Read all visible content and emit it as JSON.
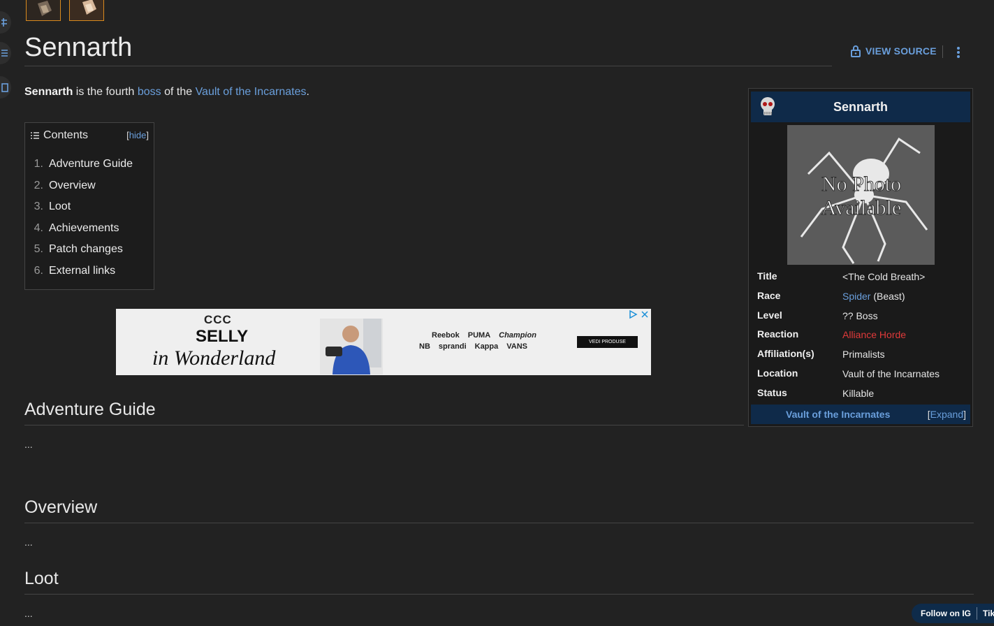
{
  "page": {
    "title": "Sennarth",
    "view_source": "VIEW SOURCE"
  },
  "intro": {
    "subject": "Sennarth",
    "text1": " is the fourth ",
    "link1": "boss",
    "text2": " of the ",
    "link2": "Vault of the Incarnates",
    "text3": "."
  },
  "toc": {
    "title": "Contents",
    "hide_open": "[",
    "hide": "hide",
    "hide_close": "]",
    "items": [
      {
        "num": "1.",
        "label": "Adventure Guide"
      },
      {
        "num": "2.",
        "label": "Overview"
      },
      {
        "num": "3.",
        "label": "Loot"
      },
      {
        "num": "4.",
        "label": "Achievements"
      },
      {
        "num": "5.",
        "label": "Patch changes"
      },
      {
        "num": "6.",
        "label": "External links"
      }
    ]
  },
  "ad": {
    "brand_top": "CCC",
    "brand_mid": "SELLY",
    "brand_script": "in Wonderland",
    "logos_row1": [
      "Reebok",
      "PUMA",
      "Champion"
    ],
    "logos_row2": [
      "NB",
      "sprandi",
      "Kappa",
      "VANS"
    ],
    "cta": "VEDI PRODUSE"
  },
  "sections": [
    {
      "heading": "Adventure Guide",
      "body": "..."
    },
    {
      "heading": "Overview",
      "body": "..."
    },
    {
      "heading": "Loot",
      "body": "..."
    }
  ],
  "infobox": {
    "name": "Sennarth",
    "photo_text_line1": "No Photo",
    "photo_text_line2": "Available",
    "rows": [
      {
        "label": "Title",
        "value": "<The Cold Breath>"
      },
      {
        "label": "Race",
        "link": "Spider",
        "value": " (Beast)"
      },
      {
        "label": "Level",
        "value": "?? Boss"
      },
      {
        "label": "Reaction",
        "value": "Alliance Horde"
      },
      {
        "label": "Affiliation(s)",
        "link": "Primalists"
      },
      {
        "label": "Location",
        "link": "Vault of the Incarnates"
      },
      {
        "label": "Status",
        "value": "Killable"
      }
    ],
    "footer_name": "Vault of the Incarnates",
    "expand_open": "[",
    "expand": "Expand",
    "expand_close": "]"
  },
  "follow": {
    "ig": "Follow on IG",
    "tik": "Tik"
  },
  "colors": {
    "background": "#222222",
    "link": "#6a9fdc",
    "horde": "#e03a3a",
    "infobox_header": "#0f2a49",
    "thumb_border": "#d98a1e"
  }
}
